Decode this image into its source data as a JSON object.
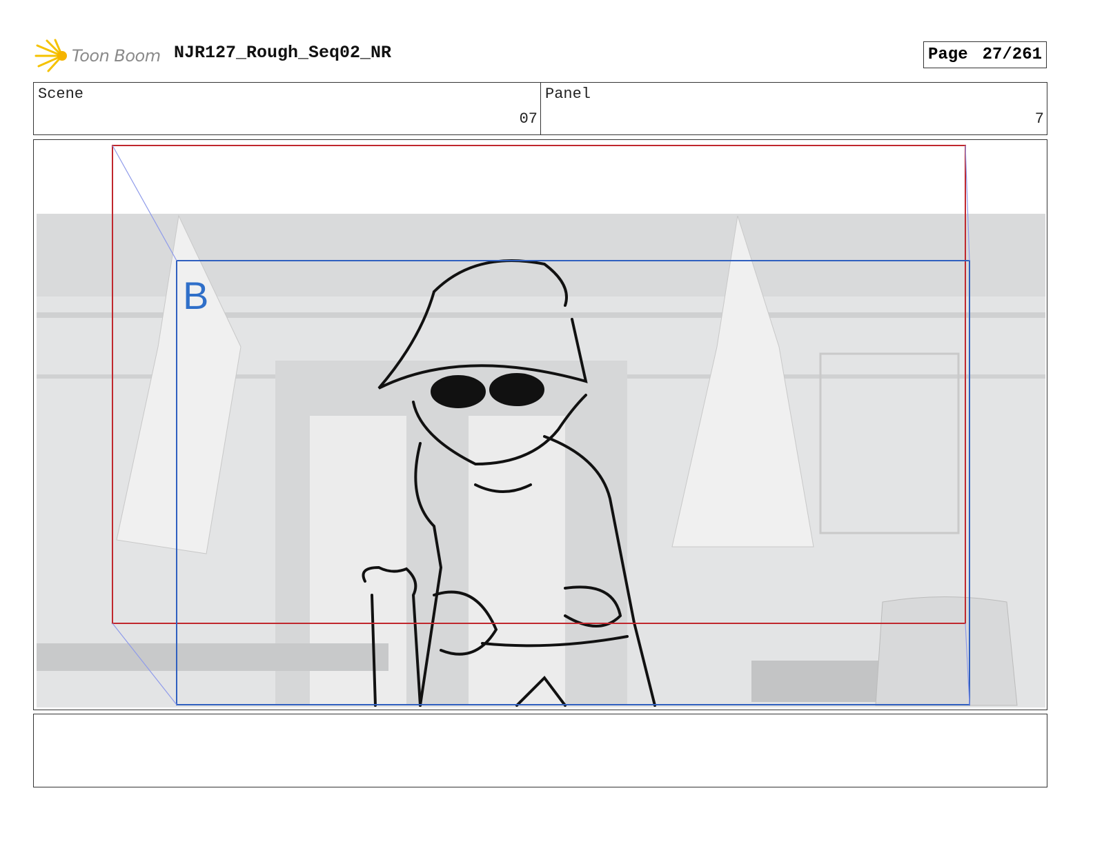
{
  "header": {
    "logo_text": "Toon Boom",
    "project_title": "NJR127_Rough_Seq02_NR",
    "page_label": "Page",
    "page_value": "27/261"
  },
  "info": {
    "scene_label": "Scene",
    "scene_value": "07",
    "panel_label": "Panel",
    "panel_value": "7"
  },
  "panel": {
    "camera_label": "B",
    "colors": {
      "start_frame": "#c0272d",
      "end_frame": "#2f5fbf",
      "background": "#e2e3e4"
    }
  },
  "caption": {
    "text": ""
  }
}
